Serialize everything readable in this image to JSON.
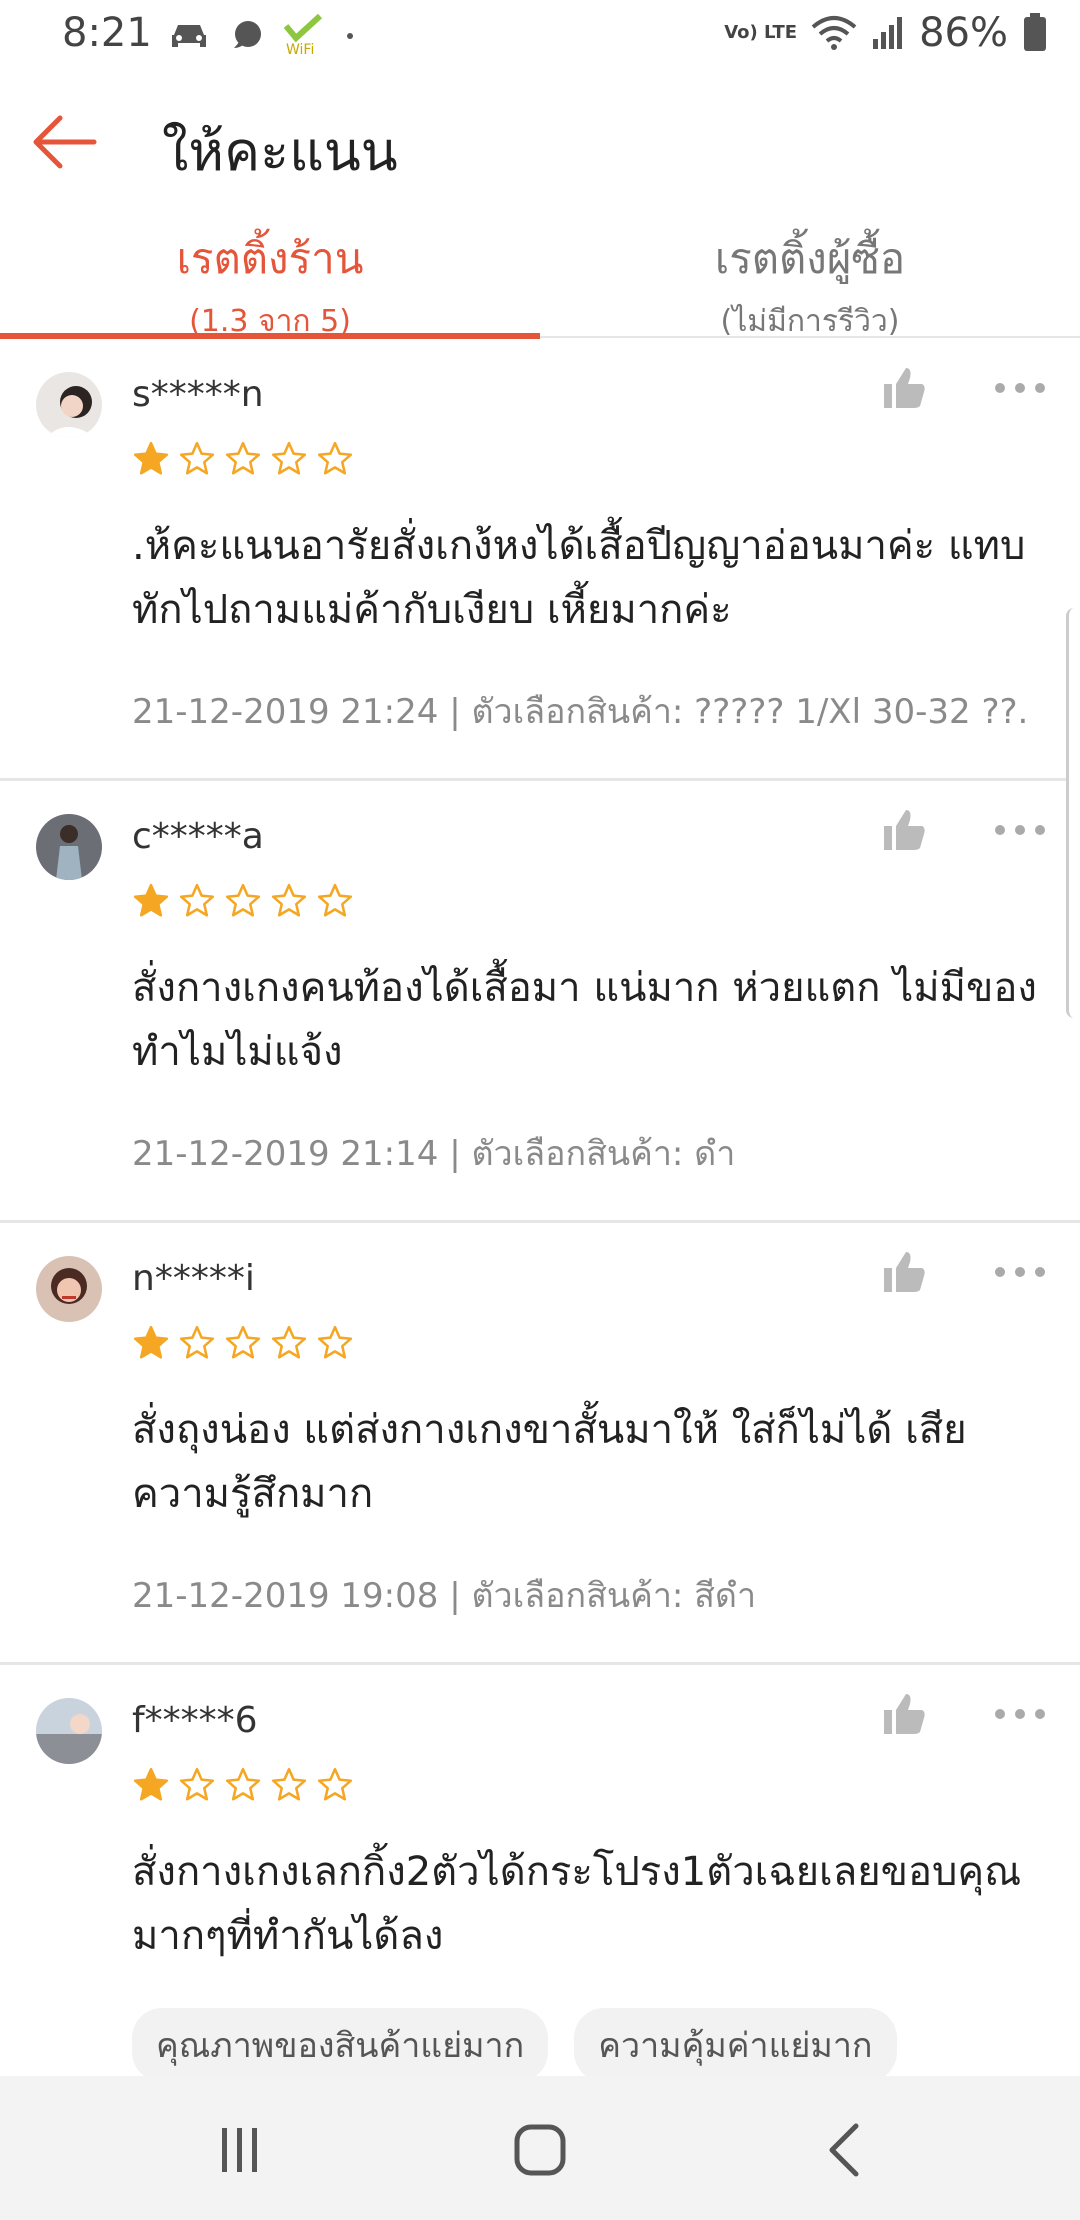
{
  "status_bar": {
    "time": "8:21",
    "battery": "86%",
    "network_label": "Vo) LTE",
    "icons": [
      "car-icon",
      "chat-icon",
      "wifi-hotspot-icon",
      "dot-icon",
      "volte-icon",
      "wifi-icon",
      "signal-icon",
      "battery-icon"
    ]
  },
  "header": {
    "title": "ให้คะแนน",
    "back_icon": "back-arrow-icon"
  },
  "tabs": [
    {
      "title": "เรตติ้งร้าน",
      "subtitle": "(1.3 จาก 5)",
      "active": true
    },
    {
      "title": "เรตติ้งผู้ซื้อ",
      "subtitle": "(ไม่มีการรีวิว)",
      "active": false
    }
  ],
  "reviews": [
    {
      "username": "s*****n",
      "rating": 1,
      "text": ".ห้คะแนนอารัยสั่งเกง้หงได้เสื้อปีญญาอ่อนมาค่ะ แทบทักไปถามแม่ค้ากับเงียบ เหี้ยมากค่ะ",
      "meta": "21-12-2019 21:24 | ตัวเลือกสินค้า: ????? 1/Xl 30-32 ??."
    },
    {
      "username": "c*****a",
      "rating": 1,
      "text": "สั่งกางเกงคนท้องได้เสื้อมา แน่มาก ห่วยแตก ไม่มีของทำไมไม่แจ้ง",
      "meta": "21-12-2019 21:14 | ตัวเลือกสินค้า: ดำ"
    },
    {
      "username": "n*****i",
      "rating": 1,
      "text": "สั่งถุงน่อง แต่ส่งกางเกงขาสั้นมาให้ ใส่ก็ไม่ได้ เสียความรู้สึกมาก",
      "meta": "21-12-2019 19:08 | ตัวเลือกสินค้า: สีดำ"
    },
    {
      "username": "f*****6",
      "rating": 1,
      "text": "สั่งกางเกงเลกกิ้ง2ตัวได้กระโปรง1ตัวเฉยเลยขอบคุณมากๆที่ทำกันได้ลง",
      "tags": [
        "คุณภาพของสินค้าแย่มาก",
        "ความคุ้มค่าแย่มาก"
      ]
    }
  ],
  "colors": {
    "accent": "#e4553a",
    "star": "#f5a623",
    "meta_text": "#8a8a8a"
  },
  "navbar": {
    "icons": [
      "recent-apps-icon",
      "home-icon",
      "back-icon"
    ]
  }
}
